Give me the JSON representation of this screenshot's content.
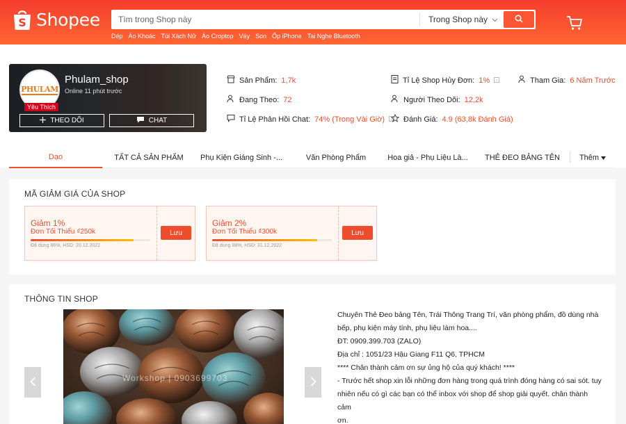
{
  "colors": {
    "brand": "#ee4d2d",
    "header_gradient_start": "#f53d2d",
    "header_gradient_end": "#ff6633"
  },
  "header": {
    "logo_text": "Shopee",
    "search_placeholder": "Tìm trong Shop này",
    "search_scope": "Trong Shop này",
    "keywords": [
      "Dép",
      "Áo Khoác",
      "Túi Xách Nữ",
      "Áo Croptop",
      "Váy",
      "Son",
      "Ốp iPhone",
      "Tai Nghe Bluetooth"
    ],
    "icons": {
      "search": "search-icon",
      "cart": "cart-icon"
    }
  },
  "shop": {
    "name": "Phulam_shop",
    "avatar_text": "PHULAM",
    "online": "Online 11 phút trước",
    "badge": "Yêu Thích",
    "follow_label": "THEO DÕI",
    "chat_label": "CHAT",
    "stats": {
      "products_label": "Sản Phẩm:",
      "products_value": "1,7k",
      "following_label": "Đang Theo:",
      "following_value": "72",
      "chat_rate_label": "Tỉ Lệ Phản Hồi Chat:",
      "chat_rate_value": "74% (Trong Vài Giờ)",
      "cancel_rate_label": "Tỉ Lệ Shop Hủy Đơn:",
      "cancel_rate_value": "1%",
      "followers_label": "Người Theo Dõi:",
      "followers_value": "12,2k",
      "rating_label": "Đánh Giá:",
      "rating_value": "4.9 (63,8k Đánh Giá)",
      "joined_label": "Tham Gia:",
      "joined_value": "6 Năm Trước"
    }
  },
  "tabs": {
    "items": [
      "Dạo",
      "TẤT CẢ SẢN PHẨM",
      "Phụ Kiện Giáng Sinh -...",
      "Văn Phòng Phẩm",
      "Hoa giả - Phụ Liệu Là...",
      "THẺ ĐEO BẢNG TÊN"
    ],
    "more": "Thêm",
    "active_index": 0
  },
  "vouchers": {
    "title": "MÃ GIẢM GIÁ CỦA SHOP",
    "items": [
      {
        "title": "Giảm 1%",
        "min": "Đơn Tối Thiểu ₫250k",
        "used": "Đã dùng 86%, HSD: 20.12.2022",
        "used_fraction": 0.86,
        "save_label": "Lưu"
      },
      {
        "title": "Giảm 2%",
        "min": "Đơn Tối Thiểu ₫300k",
        "used": "Đã dùng 88%, HSD: 31.12.2022",
        "used_fraction": 0.88,
        "save_label": "Lưu"
      }
    ]
  },
  "shop_desc": {
    "title": "THÔNG TIN SHOP",
    "watermark": "Workshop | 0903699703",
    "lines": [
      "Chuyên Thẻ Đeo bảng Tên, Trái Thông Trang Trí, văn phòng phẩm, đồ dùng nhà",
      "bếp, phụ kiện máy tính, phụ liệu làm hoa....",
      "ĐT:  0909.399.703  (ZALO)",
      "Địa chỉ : 1051/23 Hậu Giang F11 Q6, TPHCM",
      "**** Chân thành cảm ơn sự ủng hộ của quý khách! ****",
      "- Trước hết shop xin lỗi những đơn hàng trong quá trình đóng hàng có sai sót. tuy",
      "nhiên nếu có gì các bạn có thể inbox với shop để shop giải quyết. chân thành cảm",
      "ơn."
    ]
  }
}
